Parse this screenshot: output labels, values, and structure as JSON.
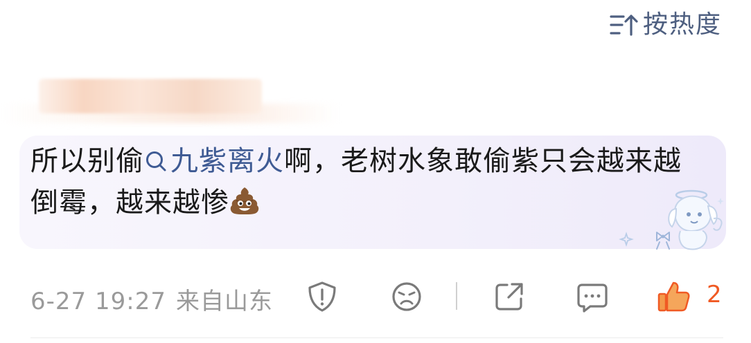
{
  "sort": {
    "label": "按热度",
    "icon": "sort-icon"
  },
  "comment": {
    "text_before": "所以别偷",
    "topic_icon": "search-icon",
    "topic_text": "九紫离火",
    "text_after": "啊，老树水象敢偷紫只会越来越倒霉，越来越惨",
    "emoji": "poop-emoji",
    "sticker": "angel-puppy-sticker"
  },
  "footer": {
    "time": "6-27 19:27",
    "location": "来自山东",
    "actions": [
      "report-icon",
      "dislike-icon",
      "share-icon",
      "reply-icon",
      "like-icon"
    ],
    "like_count": "2"
  },
  "colors": {
    "accent_blue": "#4e5f80",
    "topic_blue": "#3f5b94",
    "like_orange": "#f05a24",
    "meta_gray": "#9a9a9a",
    "bubble_bg": "#f3f0fb"
  }
}
